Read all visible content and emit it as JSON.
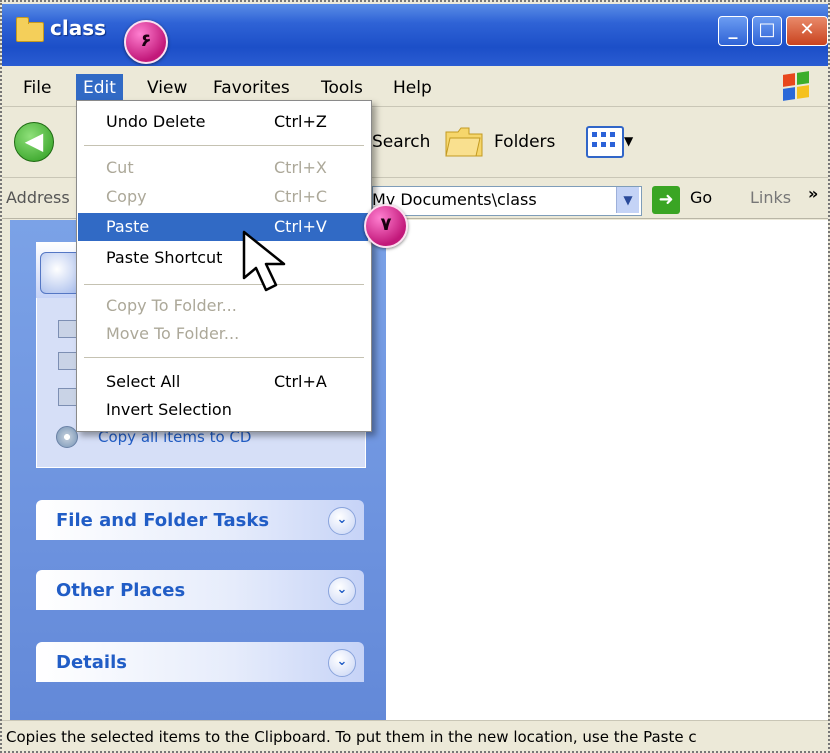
{
  "window": {
    "title": "class",
    "minimize": "_",
    "maximize": "□",
    "close": "✕"
  },
  "callouts": {
    "menu_step": "۶",
    "paste_step": "۷"
  },
  "menubar": {
    "items": [
      "File",
      "Edit",
      "View",
      "Favorites",
      "Tools",
      "Help"
    ],
    "active": "Edit"
  },
  "toolbar": {
    "back": "Back",
    "search": "Search",
    "folders": "Folders"
  },
  "address": {
    "label": "Address",
    "value": "My Documents\\class",
    "go": "Go",
    "links": "Links"
  },
  "edit_menu": {
    "items": [
      {
        "label": "Undo Delete",
        "shortcut": "Ctrl+Z",
        "enabled": true
      },
      {
        "label": "Cut",
        "shortcut": "Ctrl+X",
        "enabled": false
      },
      {
        "label": "Copy",
        "shortcut": "Ctrl+C",
        "enabled": false
      },
      {
        "label": "Paste",
        "shortcut": "Ctrl+V",
        "enabled": true,
        "highlighted": true
      },
      {
        "label": "Paste Shortcut",
        "shortcut": "",
        "enabled": true
      },
      {
        "label": "Copy To Folder...",
        "shortcut": "",
        "enabled": false
      },
      {
        "label": "Move To Folder...",
        "shortcut": "",
        "enabled": false
      },
      {
        "label": "Select All",
        "shortcut": "Ctrl+A",
        "enabled": true
      },
      {
        "label": "Invert Selection",
        "shortcut": "",
        "enabled": true
      }
    ]
  },
  "tasks": {
    "cd_link": "Copy all items to CD",
    "sections": [
      "File and Folder Tasks",
      "Other Places",
      "Details"
    ]
  },
  "status": {
    "text": "Copies the selected items to the Clipboard. To put them in the new location, use the Paste c"
  },
  "colors": {
    "title_blue": "#2f63d6",
    "menu_highlight": "#316ac5",
    "task_pane": "#7ba2e7",
    "link_blue": "#215dc6"
  }
}
